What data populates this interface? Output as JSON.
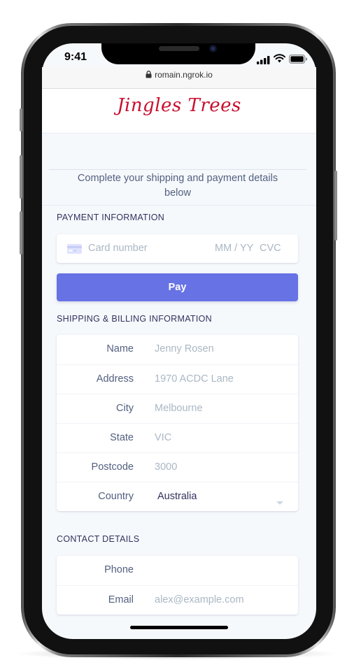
{
  "status_bar": {
    "time": "9:41"
  },
  "browser": {
    "url": "romain.ngrok.io"
  },
  "brand": {
    "logo_text": "Jingles Trees"
  },
  "intro": {
    "text": "Complete your shipping and payment details below"
  },
  "payment": {
    "section_title": "PAYMENT INFORMATION",
    "card_number_placeholder": "Card number",
    "expiry_placeholder": "MM / YY",
    "cvc_placeholder": "CVC",
    "pay_label": "Pay"
  },
  "shipping": {
    "section_title": "SHIPPING & BILLING INFORMATION",
    "fields": [
      {
        "label": "Name",
        "placeholder": "Jenny Rosen"
      },
      {
        "label": "Address",
        "placeholder": "1970 ACDC Lane"
      },
      {
        "label": "City",
        "placeholder": "Melbourne"
      },
      {
        "label": "State",
        "placeholder": "VIC"
      },
      {
        "label": "Postcode",
        "placeholder": "3000"
      }
    ],
    "country": {
      "label": "Country",
      "value": "Australia"
    }
  },
  "contact": {
    "section_title": "CONTACT DETAILS",
    "fields": [
      {
        "label": "Phone",
        "placeholder": ""
      },
      {
        "label": "Email",
        "placeholder": "alex@example.com"
      }
    ]
  },
  "colors": {
    "accent": "#6772e5",
    "brand": "#c8102e",
    "background": "#f6f9fc",
    "placeholder": "#aab7c4",
    "label": "#525f7f"
  },
  "icons": [
    "lock-icon",
    "signal-icon",
    "wifi-icon",
    "battery-icon",
    "credit-card-icon",
    "chevron-down-icon"
  ]
}
